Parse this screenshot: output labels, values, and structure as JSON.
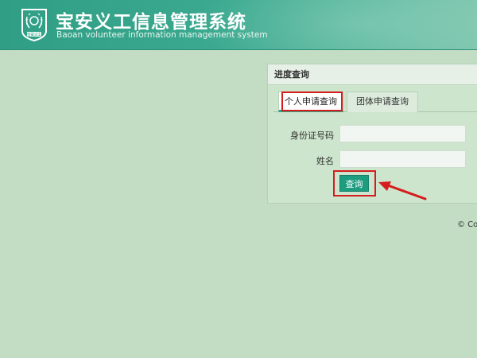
{
  "header": {
    "title_cn": "宝安义工信息管理系统",
    "title_en": "Baoan volunteer information management system",
    "logo_text": "宝安义工"
  },
  "panel": {
    "title": "进度查询",
    "tabs": [
      {
        "label": "个人申请查询",
        "active": true
      },
      {
        "label": "团体申请查询",
        "active": false
      }
    ],
    "fields": {
      "id_label": "身份证号码",
      "id_value": "",
      "name_label": "姓名",
      "name_value": ""
    },
    "query_button": "查询"
  },
  "footer": {
    "copyright": "© Cop"
  },
  "colors": {
    "background": "#c2ddc3",
    "header": "#3aa98f",
    "accent": "#1e9c80",
    "highlight": "#d51d1d"
  }
}
